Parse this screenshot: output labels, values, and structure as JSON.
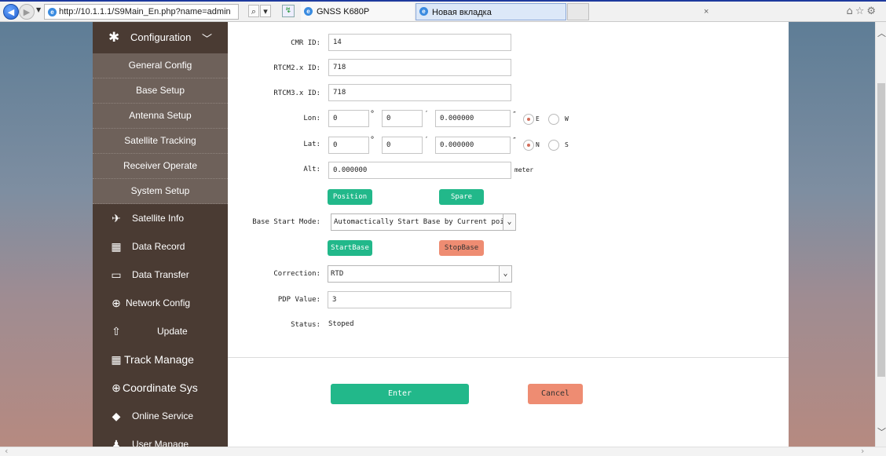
{
  "browser": {
    "url": "http://10.1.1.1/S9Main_En.php?name=admin",
    "search_glyph": "⌕",
    "dropdown_glyph": "▾",
    "tabs": [
      {
        "label": "GNSS K680P",
        "close": "×"
      },
      {
        "label": "Новая вкладка"
      }
    ],
    "toolbar_icons": "⌂☆⚙"
  },
  "sidebar": {
    "config": {
      "label": "Configuration",
      "icon": "tools-icon",
      "expanded": true
    },
    "sub_items": [
      {
        "label": "General Config"
      },
      {
        "label": "Base Setup"
      },
      {
        "label": "Antenna Setup"
      },
      {
        "label": "Satellite Tracking"
      },
      {
        "label": "Receiver Operate"
      },
      {
        "label": "System Setup"
      }
    ],
    "items": [
      {
        "label": "Satellite Info",
        "icon": "satellite-icon"
      },
      {
        "label": "Data Record",
        "icon": "calendar-icon"
      },
      {
        "label": "Data Transfer",
        "icon": "monitor-icon"
      },
      {
        "label": "Network Config",
        "icon": "globe-icon"
      },
      {
        "label": "Update",
        "icon": "upload-icon"
      },
      {
        "label": "Track Manage",
        "icon": "calendar-icon"
      },
      {
        "label": "Coordinate Sys",
        "icon": "globe-icon"
      },
      {
        "label": "Online Service",
        "icon": "cube-icon"
      },
      {
        "label": "User Manage",
        "icon": "user-icon"
      }
    ]
  },
  "form": {
    "cmr_id": {
      "label": "CMR ID:",
      "value": "14"
    },
    "rtcm2_id": {
      "label": "RTCM2.x ID:",
      "value": "718"
    },
    "rtcm3_id": {
      "label": "RTCM3.x ID:",
      "value": "718"
    },
    "lon": {
      "label": "Lon:",
      "deg": "0",
      "min": "0",
      "sec": "0.000000",
      "dir_options": [
        "E",
        "W"
      ],
      "selected": "E"
    },
    "lat": {
      "label": "Lat:",
      "deg": "0",
      "min": "0",
      "sec": "0.000000",
      "dir_options": [
        "N",
        "S"
      ],
      "selected": "N"
    },
    "alt": {
      "label": "Alt:",
      "value": "0.000000",
      "unit": "meter"
    },
    "deg_sym": "°",
    "min_sym": "′",
    "sec_sym": "″",
    "position_button": "Position",
    "spare_button": "Spare",
    "base_start_mode": {
      "label": "Base Start Mode:",
      "value": "Automactically Start Base by Current point"
    },
    "start_base_button": "StartBase",
    "stop_base_button": "StopBase",
    "correction": {
      "label": "Correction:",
      "value": "RTD"
    },
    "pdop": {
      "label": "PDP Value:",
      "value": "3"
    },
    "status": {
      "label": "Status:",
      "value": "Stoped"
    }
  },
  "footer": {
    "enter_button": "Enter",
    "cancel_button": "Cancel"
  },
  "colors": {
    "sidebar_bg": "#4a3b33",
    "submenu_bg": "#6e615a",
    "green_button": "#22b88a",
    "salmon_button": "#ee8c72"
  }
}
